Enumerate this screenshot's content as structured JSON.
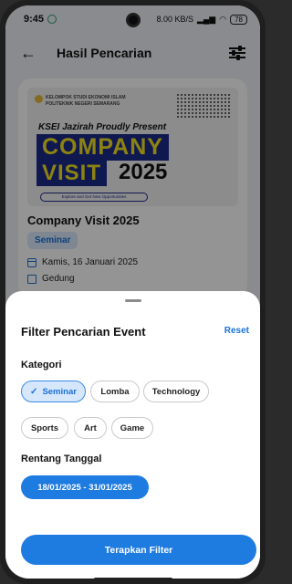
{
  "status_bar": {
    "time": "9:45",
    "right_text": "8.00 KB/S",
    "battery": "78"
  },
  "app_bar": {
    "title": "Hasil Pencarian"
  },
  "event_card": {
    "poster": {
      "org_line1": "KELOMPOK STUDI EKONOMI ISLAM",
      "org_line2": "POLITEKNIK NEGERI SEMARANG",
      "present": "KSEI Jazirah Proudly Present",
      "word1": "COMPANY",
      "word2": "VISIT",
      "year": "2025",
      "tagline": "Explore and Get New Opportunities"
    },
    "title": "Company Visit 2025",
    "category": "Seminar",
    "date": "Kamis, 16 Januari 2025",
    "location": "Gedung"
  },
  "filter_sheet": {
    "title": "Filter Pencarian Event",
    "reset_label": "Reset",
    "category_label": "Kategori",
    "categories": [
      {
        "label": "Seminar",
        "selected": true
      },
      {
        "label": "Lomba",
        "selected": false
      },
      {
        "label": "Technology",
        "selected": false
      },
      {
        "label": "Sports",
        "selected": false
      },
      {
        "label": "Art",
        "selected": false
      },
      {
        "label": "Game",
        "selected": false
      }
    ],
    "date_label": "Rentang Tanggal",
    "date_range": "18/01/2025 - 31/01/2025",
    "apply_label": "Terapkan Filter"
  },
  "colors": {
    "accent": "#1e7be0",
    "selected_chip_bg": "#d6e7fb",
    "poster_blue": "#1c2a8a",
    "poster_yellow": "#f2e21f"
  },
  "icons": [
    "back-arrow-icon",
    "tune-icon",
    "calendar-icon",
    "building-icon",
    "check-icon"
  ]
}
